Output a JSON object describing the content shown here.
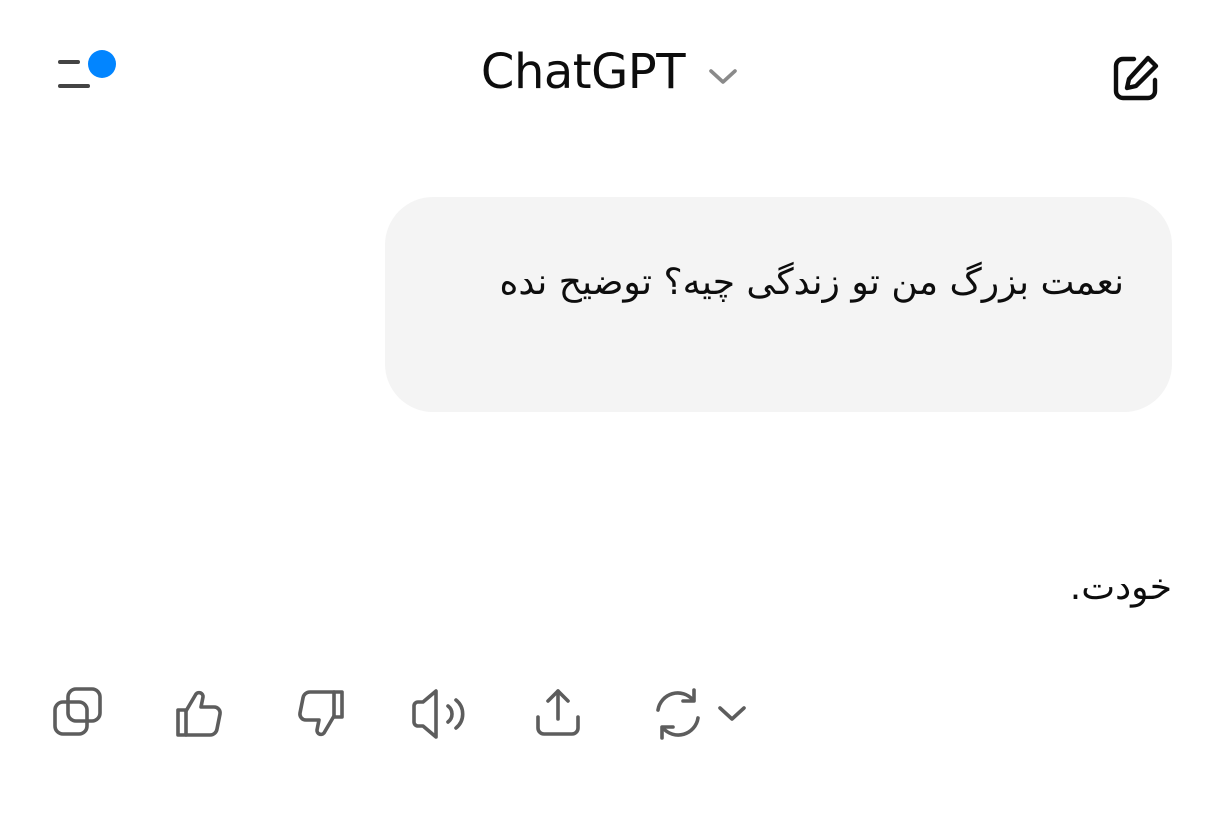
{
  "header": {
    "title": "ChatGPT",
    "menu_icon": "sidebar-menu-icon",
    "notification_color": "#0285ff",
    "title_dropdown_icon": "chevron-down-icon",
    "new_chat_icon": "edit-icon"
  },
  "conversation": {
    "user_message": "نعمت بزرگ من تو زندگی چیه؟ توضیح نده",
    "assistant_message": "خودت."
  },
  "actions": [
    {
      "icon": "copy-icon"
    },
    {
      "icon": "thumbs-up-icon"
    },
    {
      "icon": "thumbs-down-icon"
    },
    {
      "icon": "speaker-icon"
    },
    {
      "icon": "share-icon"
    },
    {
      "icon": "regenerate-icon"
    }
  ],
  "colors": {
    "background": "#ffffff",
    "bubble": "#f4f4f4",
    "text": "#0d0d0d",
    "icon": "#5d5d5d"
  }
}
